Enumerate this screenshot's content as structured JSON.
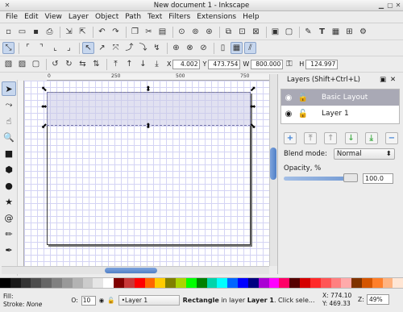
{
  "window": {
    "title": "New document 1 - Inkscape"
  },
  "menu": [
    "File",
    "Edit",
    "View",
    "Layer",
    "Object",
    "Path",
    "Text",
    "Filters",
    "Extensions",
    "Help"
  ],
  "select_toolbar": {
    "x_label": "X",
    "x_value": "4.002",
    "y_label": "Y",
    "y_value": "473.754",
    "w_label": "W",
    "w_value": "800.000",
    "h_label": "H",
    "h_value": "124.997"
  },
  "rulers": {
    "h_ticks": [
      "0",
      "250",
      "500",
      "750"
    ],
    "v_ticks": [
      "0",
      "250",
      "500",
      "750"
    ]
  },
  "layers_panel": {
    "title": "Layers (Shift+Ctrl+L)",
    "layers": [
      "Basic Layout",
      "Layer 1"
    ],
    "selected_layer": "Basic Layout",
    "blend_label": "Blend mode:",
    "blend_value": "Normal",
    "opacity_label": "Opacity, %",
    "opacity_value": "100.0",
    "opacity_level": 1.0
  },
  "palette": [
    "#000000",
    "#1a1a1a",
    "#333333",
    "#4d4d4d",
    "#666666",
    "#808080",
    "#999999",
    "#b3b3b3",
    "#cccccc",
    "#e6e6e6",
    "#ffffff",
    "#800000",
    "#c83737",
    "#ff0000",
    "#ff6600",
    "#ffcc00",
    "#808000",
    "#aad400",
    "#00ff00",
    "#008000",
    "#00d4aa",
    "#00ffff",
    "#0066ff",
    "#0000ff",
    "#000080",
    "#aa00d4",
    "#ff00ff",
    "#ff0066",
    "#550000",
    "#d40000",
    "#ff2a2a",
    "#ff5555",
    "#ff8080",
    "#ffaaaa",
    "#803300",
    "#d45500",
    "#ff7f2a",
    "#ffb380",
    "#ffe6d5"
  ],
  "status": {
    "fill_label": "Fill:",
    "stroke_label": "Stroke:",
    "stroke_value": "None",
    "opacity_label": "O:",
    "opacity_value": "10",
    "layer_select": "•Layer 1",
    "message_bold": "Rectangle",
    "message_rest": " in layer ",
    "message_layer": "Layer 1",
    "message_tail": ". Click sele...",
    "x_label": "X:",
    "x_value": "774.10",
    "y_label": "Y:",
    "y_value": "469.33",
    "z_label": "Z:",
    "z_value": "49%"
  }
}
